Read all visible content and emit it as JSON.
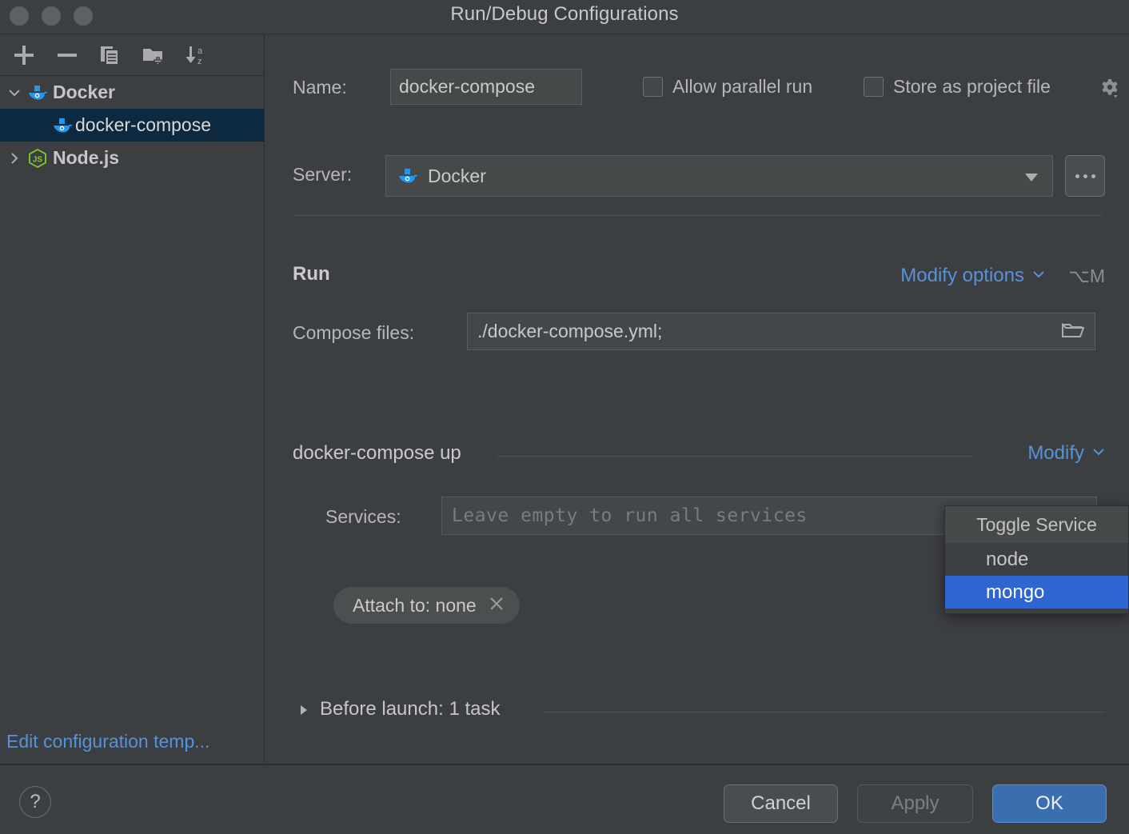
{
  "window": {
    "title": "Run/Debug Configurations",
    "traffic_lights": [
      "close",
      "minimize",
      "zoom"
    ]
  },
  "sidebar": {
    "toolbar": [
      {
        "name": "add-configuration-button",
        "icon": "plus-icon",
        "tooltip": "Add New Configuration"
      },
      {
        "name": "remove-configuration-button",
        "icon": "minus-icon",
        "tooltip": "Remove Configuration"
      },
      {
        "name": "copy-configuration-button",
        "icon": "copy-icon",
        "tooltip": "Copy Configuration"
      },
      {
        "name": "new-folder-button",
        "icon": "new-folder-icon",
        "tooltip": "Create New Folder"
      },
      {
        "name": "sort-configurations-button",
        "icon": "sort-az-icon",
        "tooltip": "Sort Configurations"
      }
    ],
    "tree": [
      {
        "label": "Docker",
        "icon": "docker-icon",
        "twisty": "expanded",
        "level": 0,
        "selected": false
      },
      {
        "label": "docker-compose",
        "icon": "docker-icon",
        "twisty": "none",
        "level": 1,
        "selected": true
      },
      {
        "label": "Node.js",
        "icon": "nodejs-icon",
        "twisty": "collapsed",
        "level": 0,
        "selected": false
      }
    ],
    "edit_templates_link": "Edit configuration temp..."
  },
  "form": {
    "name_label": "Name:",
    "name_value": "docker-compose",
    "allow_parallel_run_label": "Allow parallel run",
    "allow_parallel_run_checked": false,
    "store_as_project_file_label": "Store as project file",
    "store_as_project_file_checked": false,
    "gear_icon": "gear-dropdown-icon",
    "server_label": "Server:",
    "server_value": "Docker",
    "server_icon": "docker-icon",
    "server_browse_label": "..."
  },
  "run_section": {
    "title": "Run",
    "modify_options_label": "Modify options",
    "modify_options_shortcut": "⌥M",
    "compose_files_label": "Compose files:",
    "compose_files_value": "./docker-compose.yml;",
    "compose_files_browse_icon": "folder-icon"
  },
  "compose_up_section": {
    "title": "docker-compose up",
    "modify_label": "Modify",
    "services_label": "Services:",
    "services_value": "",
    "services_placeholder": "Leave empty to run all services",
    "services_add_icon": "plus-icon",
    "services_expand_icon": "expand-icon",
    "attach_chip_label": "Attach to: none",
    "attach_chip_close_icon": "close-icon"
  },
  "before_launch": {
    "label": "Before launch: 1 task",
    "expanded": false
  },
  "popup": {
    "header": "Toggle Service",
    "items": [
      {
        "label": "node",
        "selected": false
      },
      {
        "label": "mongo",
        "selected": true
      }
    ]
  },
  "bottom_bar": {
    "help_label": "?",
    "cancel_label": "Cancel",
    "apply_label": "Apply",
    "apply_enabled": false,
    "ok_label": "OK"
  },
  "colors": {
    "background": "#3c3f41",
    "accent_link": "#5792d8",
    "selection_blue": "#2f65d0",
    "tree_selection": "#0d293f",
    "ok_button": "#3b6eae",
    "docker_blue": "#2396ed",
    "node_green": "#83cd29"
  }
}
